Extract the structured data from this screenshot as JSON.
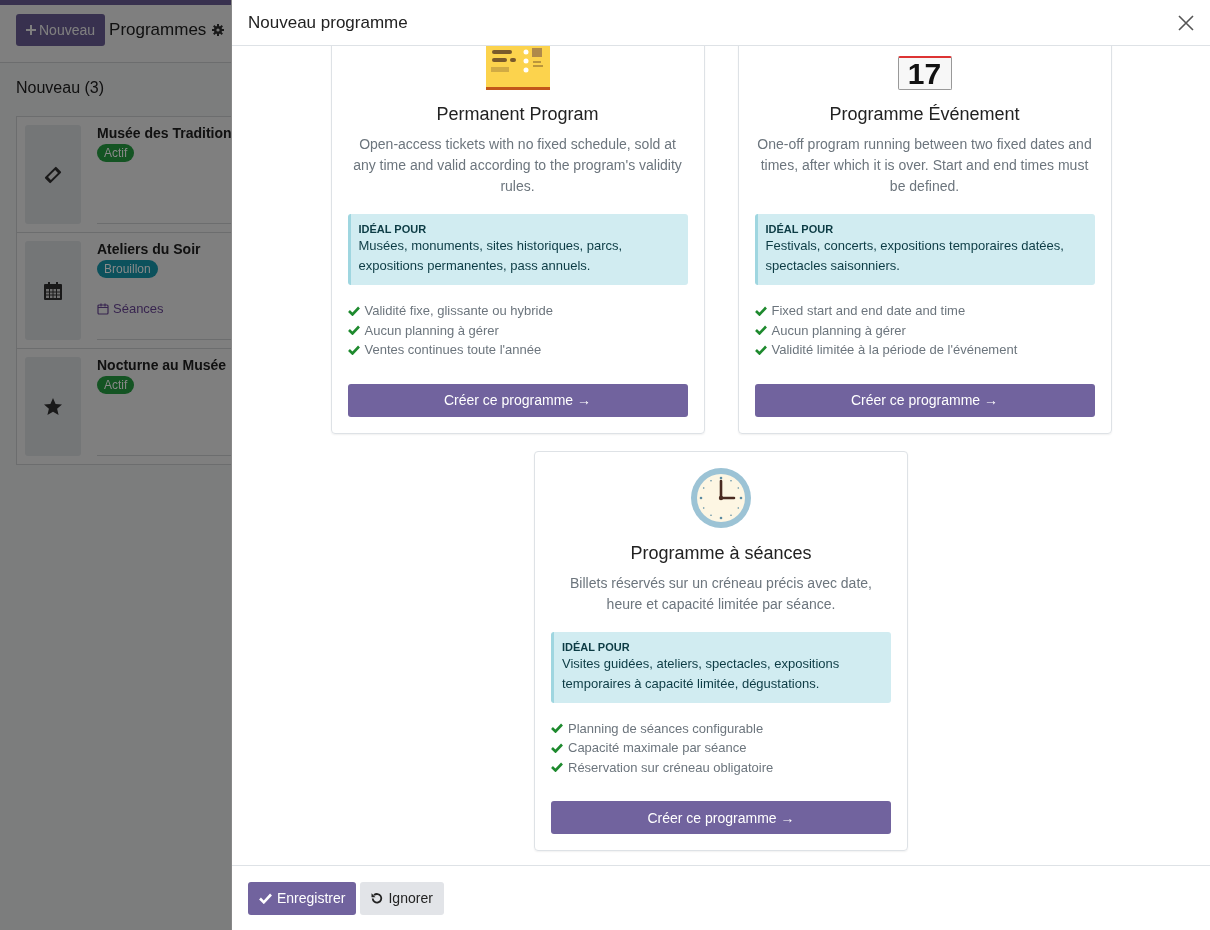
{
  "app": {
    "new_button": "Nouveau",
    "title": "Programmes",
    "group": {
      "label": "Nouveau (3)"
    },
    "records": [
      {
        "name": "Musée des Tradition",
        "status": "Actif",
        "color": "#145423",
        "kind": "ticket"
      },
      {
        "name": "Ateliers du Soir",
        "status": "Brouillon",
        "color": "#0c515c",
        "kind": "calendar",
        "link": "Séances"
      },
      {
        "name": "Nocturne au Musée",
        "status": "Actif",
        "color": "#145423",
        "kind": "star"
      }
    ]
  },
  "dialog": {
    "title": "Nouveau programme",
    "cards": [
      {
        "kind": "ticket",
        "title": "Permanent Program",
        "description": "Open-access tickets with no fixed schedule, sold at any time and valid according to the program's validity rules.",
        "ideal_label": "IDÉAL POUR",
        "ideal_text": "Musées, monuments, sites historiques, parcs, expositions permanentes, pass annuels.",
        "features": [
          "Validité fixe, glissante ou hybride",
          "Aucun planning à gérer",
          "Ventes continues toute l'année"
        ],
        "button": "Créer ce programme →"
      },
      {
        "kind": "calendar",
        "icon_text": "17",
        "title": "Programme Événement",
        "description": "One-off program running between two fixed dates and times, after which it is over. Start and end times must be defined.",
        "ideal_label": "IDÉAL POUR",
        "ideal_text": "Festivals, concerts, expositions temporaires datées, spectacles saisonniers.",
        "features": [
          "Fixed start and end date and time",
          "Aucun planning à gérer",
          "Validité limitée à la période de l'événement"
        ],
        "button": "Créer ce programme →"
      },
      {
        "kind": "clock",
        "title": "Programme à séances",
        "description": "Billets réservés sur un créneau précis avec date, heure et capacité limitée par séance.",
        "ideal_label": "IDÉAL POUR",
        "ideal_text": "Visites guidées, ateliers, spectacles, expositions temporaires à capacité limitée, dégustations.",
        "features": [
          "Planning de séances configurable",
          "Capacité maximale par séance",
          "Réservation sur créneau obligatoire"
        ],
        "button": "Créer ce programme →"
      }
    ],
    "footer": {
      "save": "Enregistrer",
      "discard": "Ignorer"
    }
  }
}
